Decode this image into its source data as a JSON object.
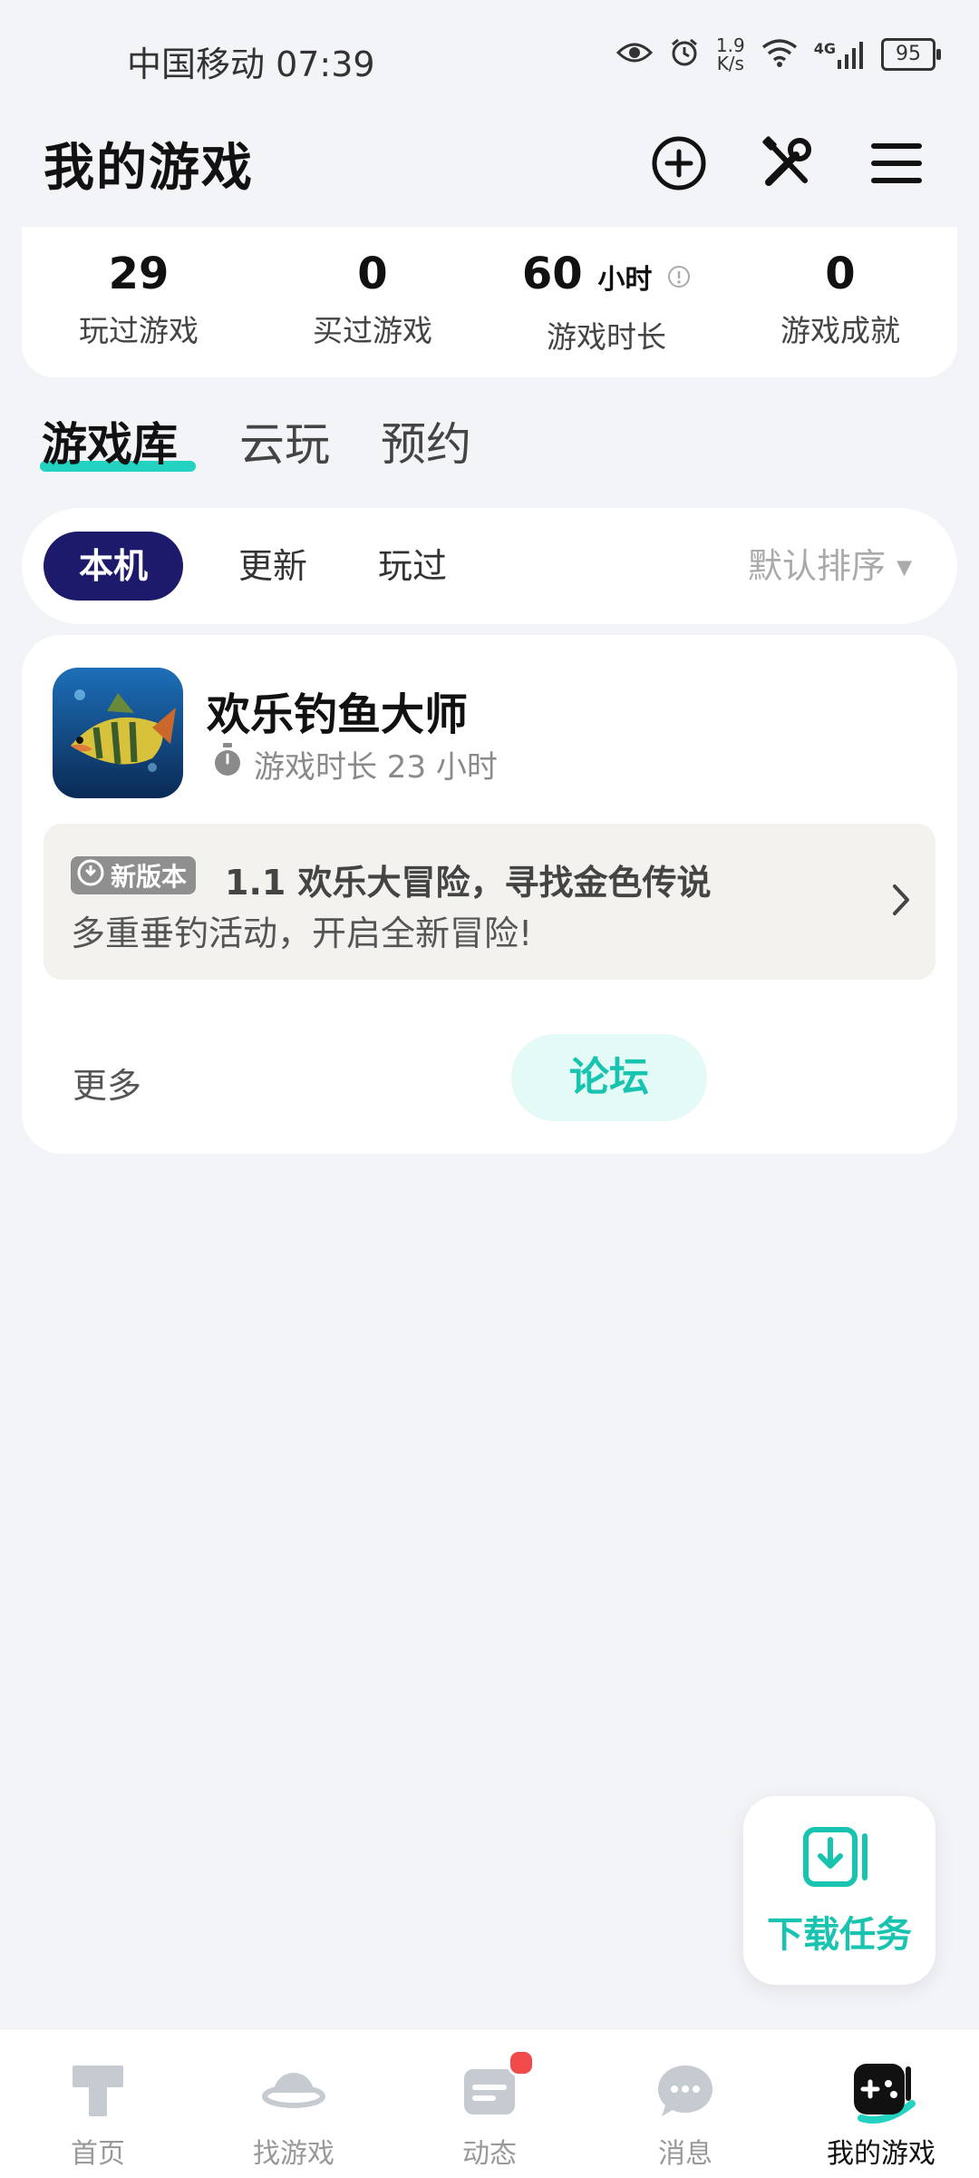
{
  "status_bar": {
    "carrier_time": "中国移动 07:39",
    "net_speed_value": "1.9",
    "net_speed_unit": "K/s",
    "network": "4G",
    "battery": "95"
  },
  "header": {
    "title": "我的游戏",
    "icons": [
      "add-circle-icon",
      "tools-icon",
      "menu-icon"
    ]
  },
  "stats": [
    {
      "value": "29",
      "unit": "",
      "label": "玩过游戏"
    },
    {
      "value": "0",
      "unit": "",
      "label": "买过游戏"
    },
    {
      "value": "60",
      "unit": "小时",
      "label": "游戏时长"
    },
    {
      "value": "0",
      "unit": "",
      "label": "游戏成就"
    }
  ],
  "tabs": [
    {
      "label": "游戏库",
      "active": true
    },
    {
      "label": "云玩",
      "active": false
    },
    {
      "label": "预约",
      "active": false
    }
  ],
  "filters": {
    "chips": [
      {
        "label": "本机",
        "active": true
      },
      {
        "label": "更新",
        "active": false
      },
      {
        "label": "玩过",
        "active": false
      }
    ],
    "sort_label": "默认排序"
  },
  "game": {
    "name": "欢乐钓鱼大师",
    "playtime": "游戏时长 23 小时",
    "update": {
      "badge": "新版本",
      "title": "1.1 欢乐大冒险，寻找金色传说",
      "description": "多重垂钓活动，开启全新冒险!"
    },
    "more_label": "更多",
    "forum_label": "论坛"
  },
  "download_fab": {
    "label": "下载任务"
  },
  "bottom_nav": [
    {
      "label": "首页",
      "icon": "home-icon",
      "active": false
    },
    {
      "label": "找游戏",
      "icon": "planet-icon",
      "active": false
    },
    {
      "label": "动态",
      "icon": "feed-icon",
      "active": false
    },
    {
      "label": "消息",
      "icon": "message-icon",
      "active": false
    },
    {
      "label": "我的游戏",
      "icon": "gamepad-icon",
      "active": true
    }
  ],
  "colors": {
    "accent": "#23d2c0",
    "chip_active": "#1d1a6b",
    "background": "#f2f4f7",
    "notification": "#f14a4a"
  }
}
